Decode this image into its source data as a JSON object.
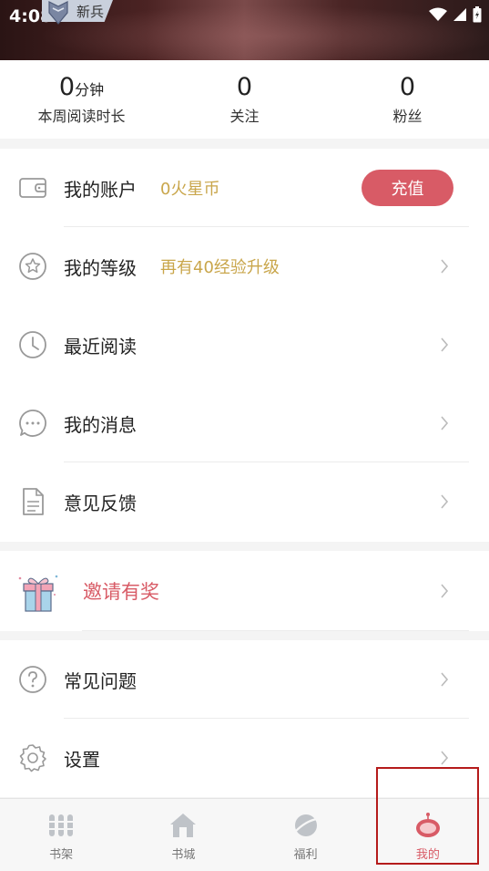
{
  "status_bar": {
    "time": "4:08",
    "rank_title": "新兵"
  },
  "stats": [
    {
      "value": "0",
      "unit": "分钟",
      "label": "本周阅读时长"
    },
    {
      "value": "0",
      "unit": "",
      "label": "关注"
    },
    {
      "value": "0",
      "unit": "",
      "label": "粉丝"
    }
  ],
  "menu": {
    "account": {
      "label": "我的账户",
      "balance": "0火星币",
      "button": "充值",
      "icon": "wallet-icon"
    },
    "level": {
      "label": "我的等级",
      "hint": "再有40经验升级",
      "icon": "star-icon"
    },
    "recent": {
      "label": "最近阅读",
      "icon": "clock-icon"
    },
    "messages": {
      "label": "我的消息",
      "icon": "chat-icon"
    },
    "feedback": {
      "label": "意见反馈",
      "icon": "document-icon"
    },
    "invite": {
      "label": "邀请有奖",
      "icon": "gift-icon"
    },
    "faq": {
      "label": "常见问题",
      "icon": "question-icon"
    },
    "settings": {
      "label": "设置",
      "icon": "gear-icon"
    }
  },
  "tabbar": {
    "items": [
      {
        "label": "书架",
        "icon": "bookshelf-icon"
      },
      {
        "label": "书城",
        "icon": "store-icon"
      },
      {
        "label": "福利",
        "icon": "planet-icon"
      },
      {
        "label": "我的",
        "icon": "robot-icon"
      }
    ],
    "active_index": 3
  },
  "colors": {
    "accent": "#d85b66",
    "gold": "#c9a64b",
    "highlight": "#b51b1b"
  }
}
